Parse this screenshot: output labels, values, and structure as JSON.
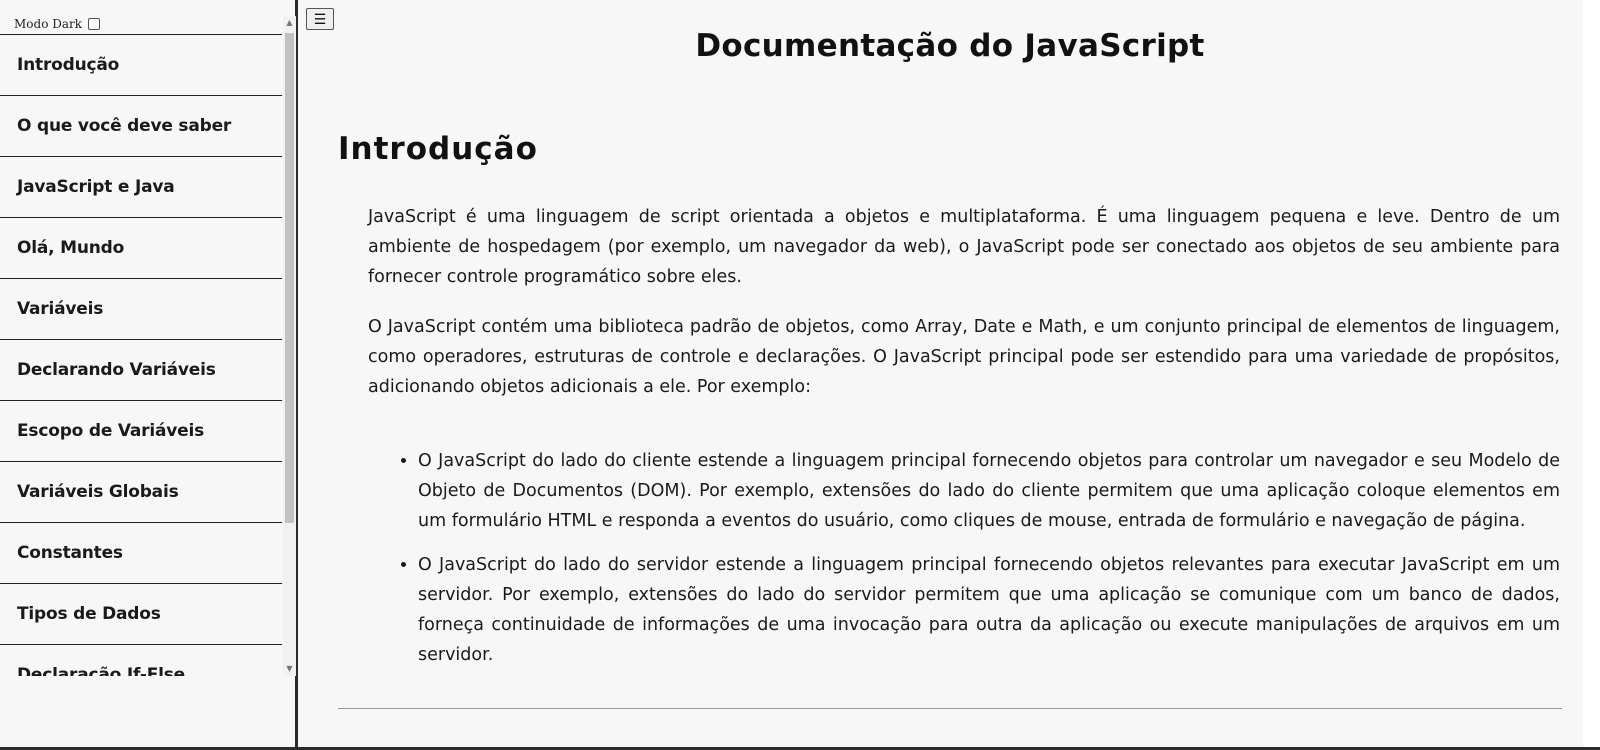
{
  "nav": {
    "dark_mode_label": "Modo Dark",
    "items": [
      {
        "label": "Introdução"
      },
      {
        "label": "O que você deve saber"
      },
      {
        "label": "JavaScript e Java"
      },
      {
        "label": "Olá, Mundo"
      },
      {
        "label": "Variáveis"
      },
      {
        "label": "Declarando Variáveis"
      },
      {
        "label": "Escopo de Variáveis"
      },
      {
        "label": "Variáveis Globais"
      },
      {
        "label": "Constantes"
      },
      {
        "label": "Tipos de Dados"
      },
      {
        "label": "Declaração If-Else"
      }
    ]
  },
  "toggle": {
    "icon_glyph": "☰"
  },
  "main": {
    "title": "Documentação do JavaScript",
    "section": {
      "title": "Introdução",
      "paragraphs": [
        "JavaScript é uma linguagem de script orientada a objetos e multiplataforma. É uma linguagem pequena e leve. Dentro de um ambiente de hospedagem (por exemplo, um navegador da web), o JavaScript pode ser conectado aos objetos de seu ambiente para fornecer controle programático sobre eles.",
        "O JavaScript contém uma biblioteca padrão de objetos, como Array, Date e Math, e um conjunto principal de elementos de linguagem, como operadores, estruturas de controle e declarações. O JavaScript principal pode ser estendido para uma variedade de propósitos, adicionando objetos adicionais a ele. Por exemplo:"
      ],
      "bullets": [
        "O JavaScript do lado do cliente estende a linguagem principal fornecendo objetos para controlar um navegador e seu Modelo de Objeto de Documentos (DOM). Por exemplo, extensões do lado do cliente permitem que uma aplicação coloque elementos em um formulário HTML e responda a eventos do usuário, como cliques de mouse, entrada de formulário e navegação de página.",
        "O JavaScript do lado do servidor estende a linguagem principal fornecendo objetos relevantes para executar JavaScript em um servidor. Por exemplo, extensões do lado do servidor permitem que uma aplicação se comunique com um banco de dados, forneça continuidade de informações de uma invocação para outra da aplicação ou execute manipulações de arquivos em um servidor."
      ]
    }
  }
}
